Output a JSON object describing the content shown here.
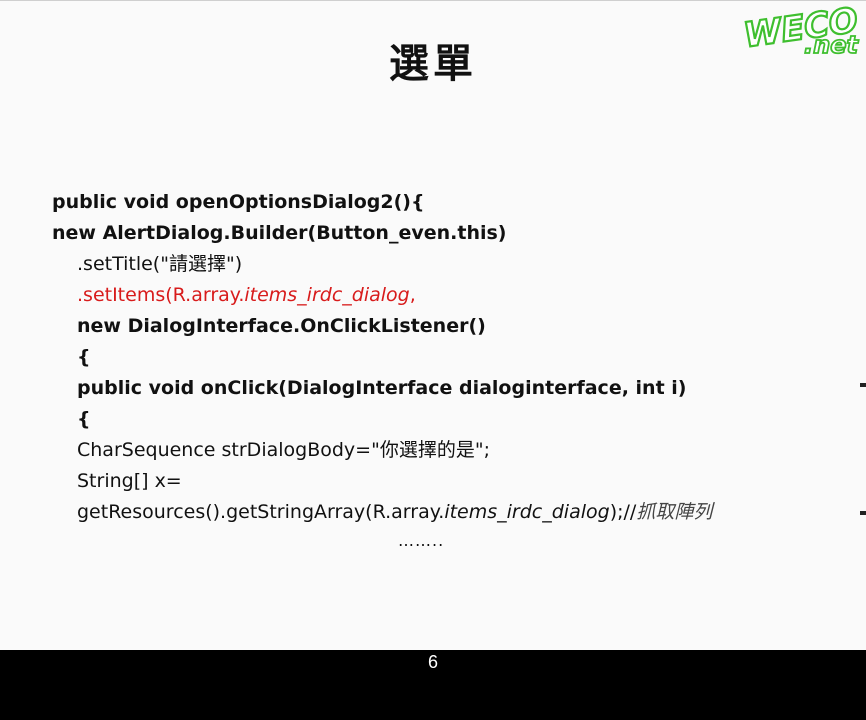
{
  "slide": {
    "title": "選單",
    "logo_text": "WECO.net",
    "page_number": "6",
    "ellipsis": "……..",
    "code": {
      "l1": "public void openOptionsDialog2(){",
      "l2": "new AlertDialog.Builder(Button_even.this)",
      "l3a": ".setTitle(\"",
      "l3b": "請選擇",
      "l3c": "\")",
      "l4a": ".setItems(R.array.",
      "l4b": "items_irdc_dialog",
      "l4c": ",",
      "l5": "new DialogInterface.OnClickListener()",
      "l6": "{",
      "l7": "public void onClick(DialogInterface dialoginterface, int i)",
      "l8": "{",
      "l9a": "CharSequence strDialogBody=\"",
      "l9b": "你選擇的是",
      "l9c": "\";",
      "l10": "String[] x=",
      "l11a": "getResources().getStringArray(R.array.",
      "l11b": "items_irdc_dialog",
      "l11c": ");//",
      "l11d": "抓取陣列"
    }
  },
  "colors": {
    "code_highlight": "#d81b1b",
    "logo_green": "#3fbf2f",
    "slide_bg": "#fafafa",
    "frame_bg": "#000000"
  }
}
